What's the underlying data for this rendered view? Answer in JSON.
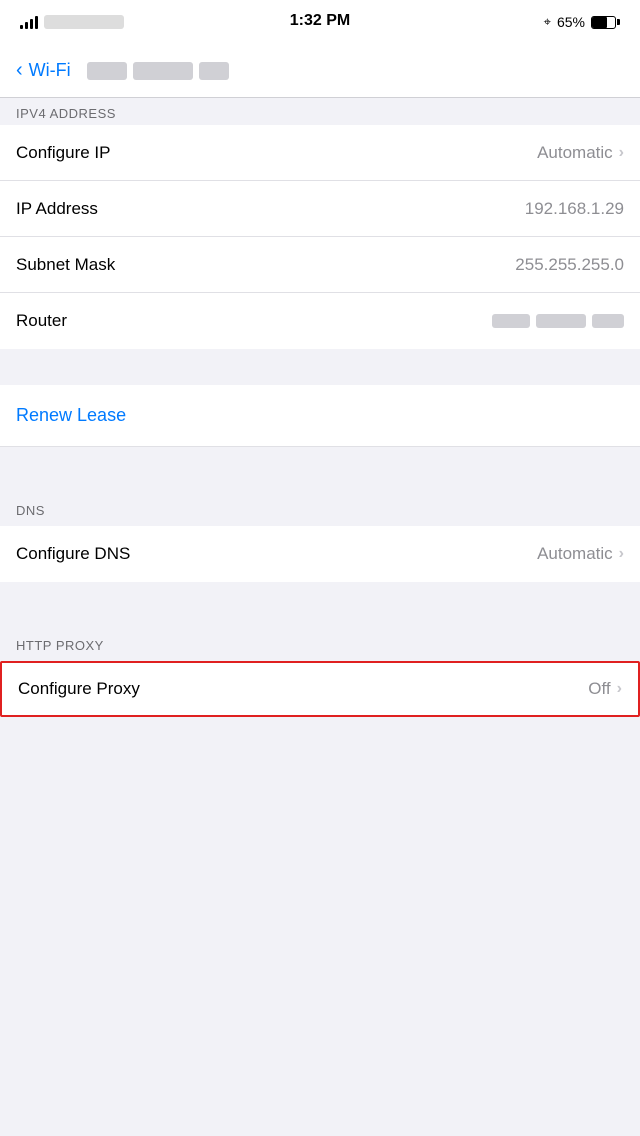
{
  "statusBar": {
    "time": "1:32 PM",
    "battery": "65%",
    "batteryFill": 65
  },
  "navBar": {
    "backLabel": "Wi-Fi",
    "networkName": "●●● ●●●●●● ●●"
  },
  "ipv4Header": "IPv4 ADDRESS",
  "rows": [
    {
      "id": "configure-ip",
      "label": "Configure IP",
      "value": "Automatic",
      "hasChevron": true,
      "blurred": false
    },
    {
      "id": "ip-address",
      "label": "IP Address",
      "value": "192.168.1.29",
      "hasChevron": false,
      "blurred": false
    },
    {
      "id": "subnet-mask",
      "label": "Subnet Mask",
      "value": "255.255.255.0",
      "hasChevron": false,
      "blurred": false
    },
    {
      "id": "router",
      "label": "Router",
      "value": "",
      "hasChevron": false,
      "blurred": true
    }
  ],
  "renewLease": {
    "label": "Renew Lease"
  },
  "dnsSection": {
    "header": "DNS",
    "rows": [
      {
        "id": "configure-dns",
        "label": "Configure DNS",
        "value": "Automatic",
        "hasChevron": true
      }
    ]
  },
  "proxySection": {
    "header": "HTTP PROXY",
    "rows": [
      {
        "id": "configure-proxy",
        "label": "Configure Proxy",
        "value": "Off",
        "hasChevron": true,
        "highlighted": true
      }
    ]
  }
}
